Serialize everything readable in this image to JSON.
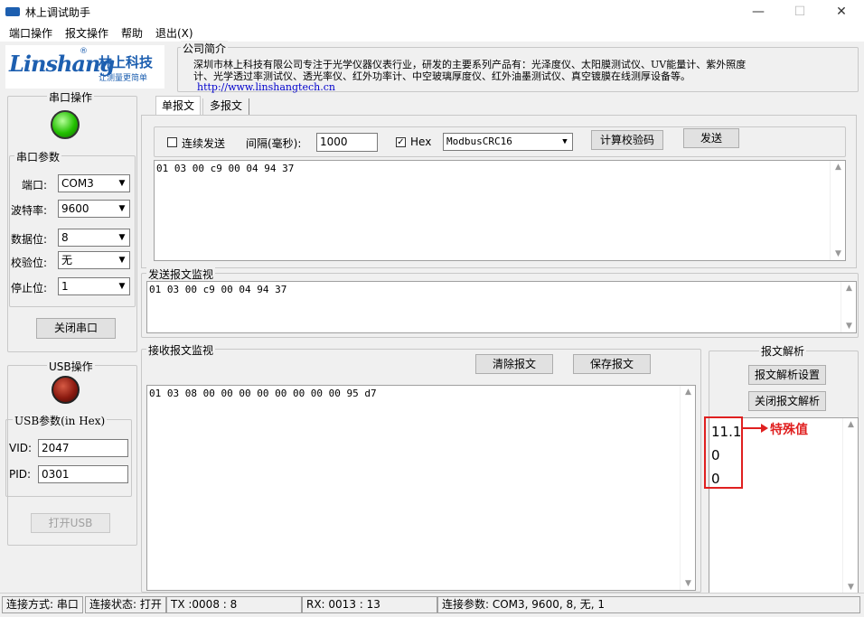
{
  "window": {
    "title": "林上调试助手",
    "minimize": "—",
    "maximize": "☐",
    "close": "✕"
  },
  "menu": [
    "端口操作",
    "报文操作",
    "帮助",
    "退出(X)"
  ],
  "logo": {
    "brand_en": "Linshang",
    "registered": "®",
    "brand_cn": "林上科技",
    "slogan": "让测量更简单"
  },
  "company": {
    "label": "公司简介",
    "line1": "深圳市林上科技有限公司专注于光学仪器仪表行业，研发的主要系列产品有：光泽度仪、太阳膜测试仪、UV能量计、紫外照度",
    "line2": "计、光学透过率测试仪、透光率仪、红外功率计、中空玻璃厚度仪、红外油墨测试仪、真空镀膜在线测厚设备等。",
    "url": "http://www.linshangtech.cn"
  },
  "serial": {
    "group_label": "串口操作",
    "params_label": "串口参数",
    "indicator_color": "#22c000",
    "fields": [
      {
        "label": "端口:",
        "value": "COM3"
      },
      {
        "label": "波特率:",
        "value": "9600"
      },
      {
        "label": "数据位:",
        "value": "8"
      },
      {
        "label": "校验位:",
        "value": "无"
      },
      {
        "label": "停止位:",
        "value": "1"
      }
    ],
    "close_button": "关闭串口"
  },
  "usb": {
    "group_label": "USB操作",
    "params_label": "USB参数(in Hex)",
    "indicator_color": "#8b1a10",
    "vid_label": "VID:",
    "vid_value": "2047",
    "pid_label": "PID:",
    "pid_value": "0301",
    "open_button": "打开USB"
  },
  "tabs": [
    {
      "label": "单报文",
      "active": true
    },
    {
      "label": "多报文",
      "active": false
    }
  ],
  "send_controls": {
    "continuous_label": "连续发送",
    "continuous_checked": false,
    "interval_label": "间隔(毫秒):",
    "interval_value": "1000",
    "hex_label": "Hex",
    "hex_checked": true,
    "checksum_type": "ModbusCRC16",
    "calc_button": "计算校验码",
    "send_button": "发送"
  },
  "send_message": "01 03 00 c9 00 04 94 37",
  "send_monitor": {
    "label": "发送报文监视",
    "content": "01 03 00 c9 00 04 94 37"
  },
  "recv_monitor": {
    "label": "接收报文监视",
    "clear_button": "清除报文",
    "save_button": "保存报文",
    "content": "01 03 08 00 00 00 00 00 00 00 00 95 d7"
  },
  "parse": {
    "label": "报文解析",
    "settings_button": "报文解析设置",
    "close_button": "关闭报文解析",
    "values": [
      "11.1",
      "0",
      "0"
    ],
    "annotation": "特殊值",
    "annotation_color": "#e02020"
  },
  "status": {
    "mode": "连接方式: 串口",
    "state": "连接状态: 打开",
    "tx": "TX :0008 : 8",
    "rx": "RX: 0013 : 13",
    "params": "连接参数: COM3, 9600, 8, 无, 1"
  }
}
